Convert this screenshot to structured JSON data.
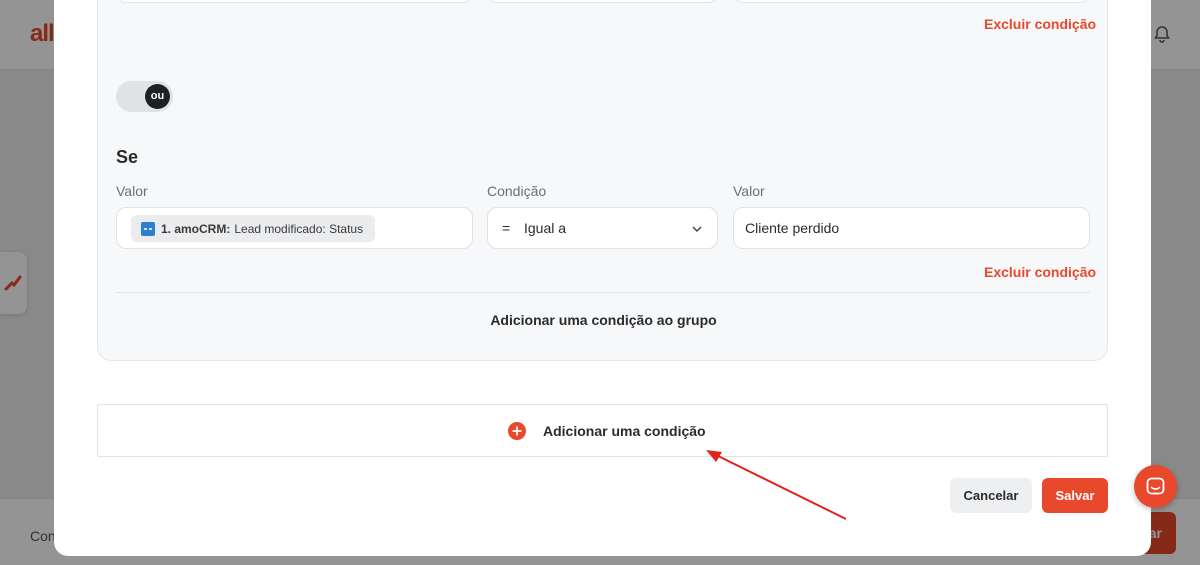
{
  "background": {
    "logo_text": "all",
    "footer_text": "Con",
    "footer_button": "ar"
  },
  "modal": {
    "group": {
      "top_delete_link": "Excluir condição",
      "toggle_label": "ou",
      "if_title": "Se",
      "labels": {
        "value_left": "Valor",
        "condition": "Condição",
        "value_right": "Valor"
      },
      "value_chip": {
        "app": "1. amoCRM:",
        "field": "Lead modificado: Status"
      },
      "condition_select": {
        "symbol": "=",
        "selected": "Igual a"
      },
      "value_input": "Cliente perdido",
      "delete_link": "Excluir condição",
      "add_to_group": "Adicionar uma condição ao grupo"
    },
    "add_condition": "Adicionar uma condição",
    "buttons": {
      "cancel": "Cancelar",
      "save": "Salvar"
    }
  },
  "colors": {
    "accent": "#e8482c",
    "annotation_arrow": "#e3221b",
    "chip_icon": "#2f7fd1"
  },
  "icons": [
    "bell-icon",
    "zap-icon",
    "chevron-down-icon",
    "plus-circle-icon",
    "chat-icon",
    "amocrm-icon"
  ]
}
